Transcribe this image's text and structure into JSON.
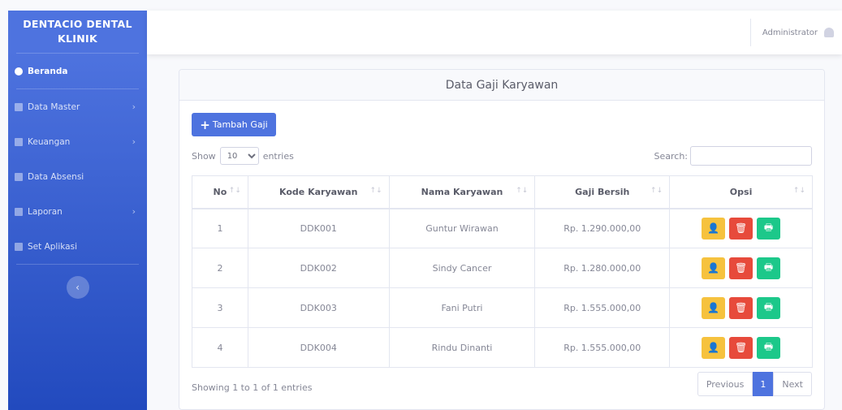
{
  "brand": {
    "line1": "DENTACIO DENTAL",
    "line2": "KLINIK"
  },
  "sidebar": {
    "items": [
      {
        "label": "Beranda",
        "icon": "dashboard-icon",
        "submenu": false
      },
      {
        "label": "Data Master",
        "icon": "database-icon",
        "submenu": true
      },
      {
        "label": "Keuangan",
        "icon": "money-icon",
        "submenu": true
      },
      {
        "label": "Data Absensi",
        "icon": "calendar-icon",
        "submenu": false
      },
      {
        "label": "Laporan",
        "icon": "report-icon",
        "submenu": true
      },
      {
        "label": "Set Aplikasi",
        "icon": "gear-icon",
        "submenu": false
      }
    ],
    "toggle_glyph": "‹",
    "chevron_glyph": "›"
  },
  "topbar": {
    "user": "Administrator"
  },
  "card": {
    "title": "Data Gaji Karyawan",
    "add_button": "Tambah Gaji",
    "add_glyph": "+"
  },
  "length": {
    "show": "Show",
    "value": "10",
    "suffix": "entries"
  },
  "search": {
    "label": "Search:",
    "value": ""
  },
  "table": {
    "columns": [
      "No",
      "Kode Karyawan",
      "Nama Karyawan",
      "Gaji Bersih",
      "Opsi"
    ],
    "sort_glyph": "↑↓",
    "rows": [
      {
        "no": "1",
        "kode": "DDK001",
        "nama": "Guntur Wirawan",
        "gaji": "Rp. 1.290.000,00"
      },
      {
        "no": "2",
        "kode": "DDK002",
        "nama": "Sindy Cancer",
        "gaji": "Rp. 1.280.000,00"
      },
      {
        "no": "3",
        "kode": "DDK003",
        "nama": "Fani Putri",
        "gaji": "Rp. 1.555.000,00"
      },
      {
        "no": "4",
        "kode": "DDK004",
        "nama": "Rindu Dinanti",
        "gaji": "Rp. 1.555.000,00"
      }
    ],
    "action_glyphs": {
      "detail": "👤",
      "delete": "🗑",
      "print": "🖶"
    }
  },
  "footer": {
    "info": "Showing 1 to 1 of 1 entries",
    "previous": "Previous",
    "page": "1",
    "next": "Next"
  },
  "colors": {
    "primary": "#4e73df",
    "warning": "#f6c23e",
    "danger": "#e74a3b",
    "success": "#1cc88a"
  }
}
